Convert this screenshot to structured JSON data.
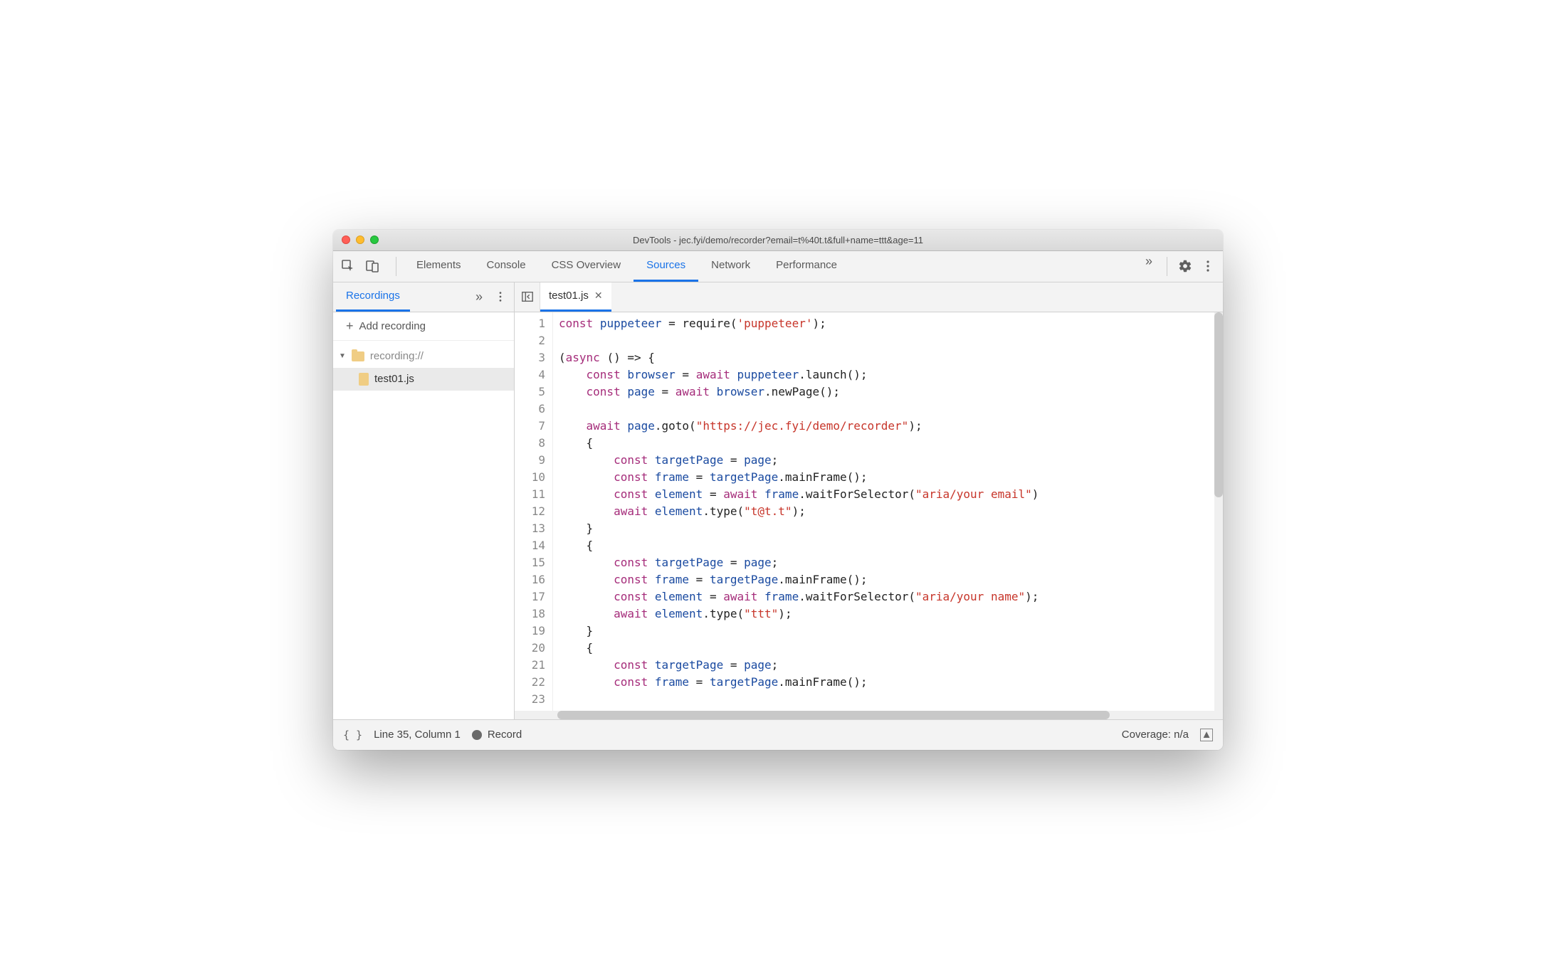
{
  "window": {
    "title": "DevTools - jec.fyi/demo/recorder?email=t%40t.t&full+name=ttt&age=11"
  },
  "toolbar": {
    "tabs": [
      "Elements",
      "Console",
      "CSS Overview",
      "Sources",
      "Network",
      "Performance"
    ],
    "active_tab": "Sources",
    "overflow_glyph": "»"
  },
  "sidebar": {
    "tab_label": "Recordings",
    "overflow_glyph": "»",
    "add_label": "Add recording",
    "tree": {
      "root_label": "recording://",
      "file_label": "test01.js"
    }
  },
  "editor": {
    "open_file": "test01.js",
    "line_count": 23,
    "code_tokens": [
      [
        [
          "kw",
          "const"
        ],
        [
          "punc",
          " "
        ],
        [
          "ident",
          "puppeteer"
        ],
        [
          "punc",
          " = "
        ],
        [
          "func",
          "require"
        ],
        [
          "paren",
          "("
        ],
        [
          "str",
          "'puppeteer'"
        ],
        [
          "paren",
          ")"
        ],
        [
          "punc",
          ";"
        ]
      ],
      [],
      [
        [
          "paren",
          "("
        ],
        [
          "kw",
          "async"
        ],
        [
          "punc",
          " "
        ],
        [
          "paren",
          "()"
        ],
        [
          "punc",
          " "
        ],
        [
          "arrow",
          "=>"
        ],
        [
          "punc",
          " "
        ],
        [
          "paren",
          "{"
        ]
      ],
      [
        [
          "punc",
          "    "
        ],
        [
          "kw",
          "const"
        ],
        [
          "punc",
          " "
        ],
        [
          "ident",
          "browser"
        ],
        [
          "punc",
          " = "
        ],
        [
          "kw",
          "await"
        ],
        [
          "punc",
          " "
        ],
        [
          "ident",
          "puppeteer"
        ],
        [
          "punc",
          "."
        ],
        [
          "func",
          "launch"
        ],
        [
          "paren",
          "()"
        ],
        [
          "punc",
          ";"
        ]
      ],
      [
        [
          "punc",
          "    "
        ],
        [
          "kw",
          "const"
        ],
        [
          "punc",
          " "
        ],
        [
          "ident",
          "page"
        ],
        [
          "punc",
          " = "
        ],
        [
          "kw",
          "await"
        ],
        [
          "punc",
          " "
        ],
        [
          "ident",
          "browser"
        ],
        [
          "punc",
          "."
        ],
        [
          "func",
          "newPage"
        ],
        [
          "paren",
          "()"
        ],
        [
          "punc",
          ";"
        ]
      ],
      [],
      [
        [
          "punc",
          "    "
        ],
        [
          "kw",
          "await"
        ],
        [
          "punc",
          " "
        ],
        [
          "ident",
          "page"
        ],
        [
          "punc",
          "."
        ],
        [
          "func",
          "goto"
        ],
        [
          "paren",
          "("
        ],
        [
          "str",
          "\"https://jec.fyi/demo/recorder\""
        ],
        [
          "paren",
          ")"
        ],
        [
          "punc",
          ";"
        ]
      ],
      [
        [
          "punc",
          "    "
        ],
        [
          "paren",
          "{"
        ]
      ],
      [
        [
          "punc",
          "        "
        ],
        [
          "kw",
          "const"
        ],
        [
          "punc",
          " "
        ],
        [
          "ident",
          "targetPage"
        ],
        [
          "punc",
          " = "
        ],
        [
          "ident",
          "page"
        ],
        [
          "punc",
          ";"
        ]
      ],
      [
        [
          "punc",
          "        "
        ],
        [
          "kw",
          "const"
        ],
        [
          "punc",
          " "
        ],
        [
          "ident",
          "frame"
        ],
        [
          "punc",
          " = "
        ],
        [
          "ident",
          "targetPage"
        ],
        [
          "punc",
          "."
        ],
        [
          "func",
          "mainFrame"
        ],
        [
          "paren",
          "()"
        ],
        [
          "punc",
          ";"
        ]
      ],
      [
        [
          "punc",
          "        "
        ],
        [
          "kw",
          "const"
        ],
        [
          "punc",
          " "
        ],
        [
          "ident",
          "element"
        ],
        [
          "punc",
          " = "
        ],
        [
          "kw",
          "await"
        ],
        [
          "punc",
          " "
        ],
        [
          "ident",
          "frame"
        ],
        [
          "punc",
          "."
        ],
        [
          "func",
          "waitForSelector"
        ],
        [
          "paren",
          "("
        ],
        [
          "str",
          "\"aria/your email\""
        ],
        [
          "paren",
          ")"
        ]
      ],
      [
        [
          "punc",
          "        "
        ],
        [
          "kw",
          "await"
        ],
        [
          "punc",
          " "
        ],
        [
          "ident",
          "element"
        ],
        [
          "punc",
          "."
        ],
        [
          "func",
          "type"
        ],
        [
          "paren",
          "("
        ],
        [
          "str",
          "\"t@t.t\""
        ],
        [
          "paren",
          ")"
        ],
        [
          "punc",
          ";"
        ]
      ],
      [
        [
          "punc",
          "    "
        ],
        [
          "paren",
          "}"
        ]
      ],
      [
        [
          "punc",
          "    "
        ],
        [
          "paren",
          "{"
        ]
      ],
      [
        [
          "punc",
          "        "
        ],
        [
          "kw",
          "const"
        ],
        [
          "punc",
          " "
        ],
        [
          "ident",
          "targetPage"
        ],
        [
          "punc",
          " = "
        ],
        [
          "ident",
          "page"
        ],
        [
          "punc",
          ";"
        ]
      ],
      [
        [
          "punc",
          "        "
        ],
        [
          "kw",
          "const"
        ],
        [
          "punc",
          " "
        ],
        [
          "ident",
          "frame"
        ],
        [
          "punc",
          " = "
        ],
        [
          "ident",
          "targetPage"
        ],
        [
          "punc",
          "."
        ],
        [
          "func",
          "mainFrame"
        ],
        [
          "paren",
          "()"
        ],
        [
          "punc",
          ";"
        ]
      ],
      [
        [
          "punc",
          "        "
        ],
        [
          "kw",
          "const"
        ],
        [
          "punc",
          " "
        ],
        [
          "ident",
          "element"
        ],
        [
          "punc",
          " = "
        ],
        [
          "kw",
          "await"
        ],
        [
          "punc",
          " "
        ],
        [
          "ident",
          "frame"
        ],
        [
          "punc",
          "."
        ],
        [
          "func",
          "waitForSelector"
        ],
        [
          "paren",
          "("
        ],
        [
          "str",
          "\"aria/your name\""
        ],
        [
          "paren",
          ")"
        ],
        [
          "punc",
          ";"
        ]
      ],
      [
        [
          "punc",
          "        "
        ],
        [
          "kw",
          "await"
        ],
        [
          "punc",
          " "
        ],
        [
          "ident",
          "element"
        ],
        [
          "punc",
          "."
        ],
        [
          "func",
          "type"
        ],
        [
          "paren",
          "("
        ],
        [
          "str",
          "\"ttt\""
        ],
        [
          "paren",
          ")"
        ],
        [
          "punc",
          ";"
        ]
      ],
      [
        [
          "punc",
          "    "
        ],
        [
          "paren",
          "}"
        ]
      ],
      [
        [
          "punc",
          "    "
        ],
        [
          "paren",
          "{"
        ]
      ],
      [
        [
          "punc",
          "        "
        ],
        [
          "kw",
          "const"
        ],
        [
          "punc",
          " "
        ],
        [
          "ident",
          "targetPage"
        ],
        [
          "punc",
          " = "
        ],
        [
          "ident",
          "page"
        ],
        [
          "punc",
          ";"
        ]
      ],
      [
        [
          "punc",
          "        "
        ],
        [
          "kw",
          "const"
        ],
        [
          "punc",
          " "
        ],
        [
          "ident",
          "frame"
        ],
        [
          "punc",
          " = "
        ],
        [
          "ident",
          "targetPage"
        ],
        [
          "punc",
          "."
        ],
        [
          "func",
          "mainFrame"
        ],
        [
          "paren",
          "()"
        ],
        [
          "punc",
          ";"
        ]
      ],
      []
    ]
  },
  "status": {
    "position": "Line 35, Column 1",
    "record_label": "Record",
    "coverage_label": "Coverage: n/a"
  }
}
